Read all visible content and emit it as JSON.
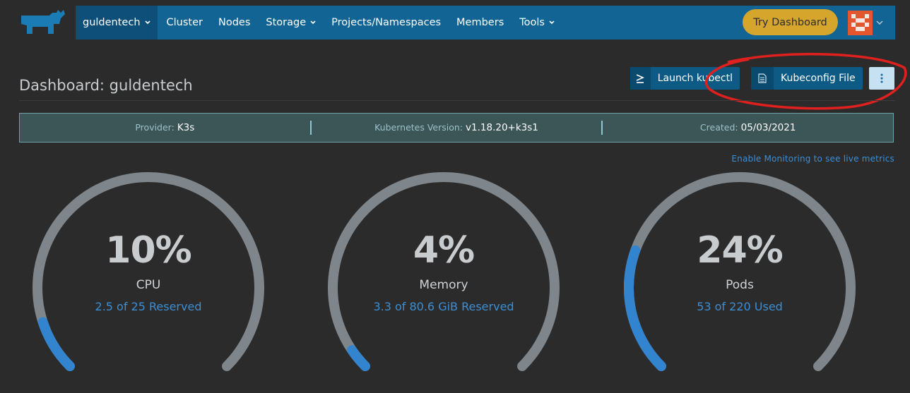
{
  "header": {
    "cluster_name": "guldentech",
    "nav": [
      "Cluster",
      "Nodes",
      "Storage",
      "Projects/Namespaces",
      "Members",
      "Tools"
    ],
    "try_dashboard": "Try Dashboard"
  },
  "page": {
    "title": "Dashboard: guldentech",
    "kubectl_button": "Launch kubectl",
    "kubeconfig_button": "Kubeconfig File"
  },
  "info": {
    "provider_label": "Provider:",
    "provider_value": "K3s",
    "k8s_label": "Kubernetes Version:",
    "k8s_value": "v1.18.20+k3s1",
    "created_label": "Created:",
    "created_value": "05/03/2021"
  },
  "monitoring_link": "Enable Monitoring to see live metrics",
  "gauges": [
    {
      "percent": "10%",
      "value": 0.1,
      "name": "CPU",
      "detail": "2.5 of 25 Reserved"
    },
    {
      "percent": "4%",
      "value": 0.04,
      "name": "Memory",
      "detail": "3.3 of 80.6 GiB Reserved"
    },
    {
      "percent": "24%",
      "value": 0.24,
      "name": "Pods",
      "detail": "53 of 220 Used"
    }
  ],
  "colors": {
    "navbar": "#116494",
    "accent": "#3b8fd6",
    "try_button": "#d6a52c",
    "gauge_track": "#7f868b",
    "gauge_fill": "#3384ce",
    "annotation": "#e0201f"
  }
}
